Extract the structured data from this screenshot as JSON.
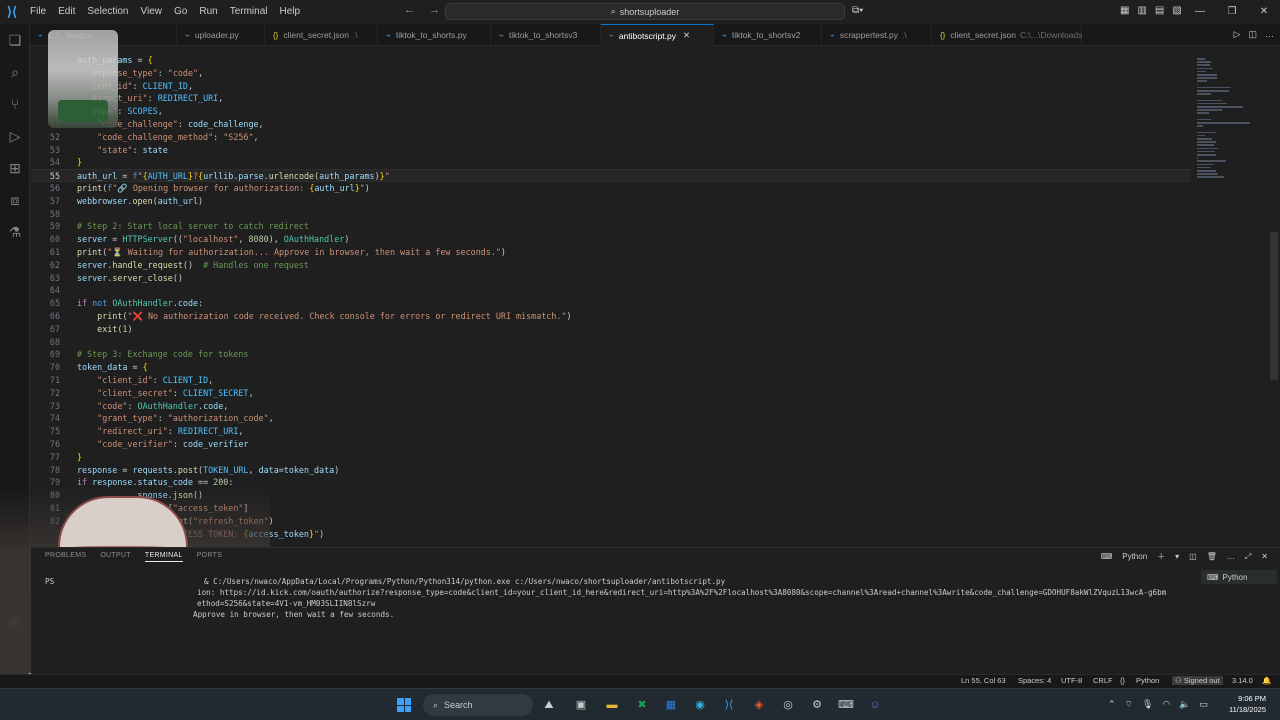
{
  "menu": [
    "File",
    "Edit",
    "Selection",
    "View",
    "Go",
    "Run",
    "Terminal",
    "Help"
  ],
  "search_box": "shortsuploader",
  "tabs": [
    {
      "label": "C:\\...\\nwaco",
      "hint": "",
      "type": "py"
    },
    {
      "label": "uploader.py",
      "hint": "",
      "type": "py"
    },
    {
      "label": "client_secret.json",
      "hint": ".\\",
      "type": "json"
    },
    {
      "label": "tiktok_to_shorts.py",
      "hint": "",
      "type": "py"
    },
    {
      "label": "tiktok_to_shortsv3",
      "hint": "",
      "type": "py"
    },
    {
      "label": "antibotscript.py",
      "hint": "",
      "type": "py",
      "active": true
    },
    {
      "label": "tiktok_to_shortsv2",
      "hint": "",
      "type": "py"
    },
    {
      "label": "scrappertest.py",
      "hint": ".\\",
      "type": "py"
    },
    {
      "label": "client_secret.json",
      "hint": "C:\\...\\Downloads",
      "type": "json"
    }
  ],
  "code_lines": [
    {
      "n": "",
      "parts": [
        [
          "k-var",
          "auth_params"
        ],
        [
          "",
          " = "
        ],
        [
          "k-brace",
          "{"
        ]
      ]
    },
    {
      "n": "",
      "parts": [
        [
          "",
          "   "
        ],
        [
          "k-str",
          "esponse_type\""
        ],
        [
          "",
          ": "
        ],
        [
          "k-str",
          "\"code\""
        ],
        [
          "",
          ","
        ]
      ]
    },
    {
      "n": "",
      "parts": [
        [
          "",
          "   "
        ],
        [
          "k-str",
          "ient_id\""
        ],
        [
          "",
          ": "
        ],
        [
          "k-con",
          "CLIENT_ID"
        ],
        [
          "",
          ","
        ]
      ]
    },
    {
      "n": "",
      "parts": [
        [
          "",
          "   "
        ],
        [
          "k-str",
          "direct_uri\""
        ],
        [
          "",
          ": "
        ],
        [
          "k-con",
          "REDIRECT_URI"
        ],
        [
          "",
          ","
        ]
      ]
    },
    {
      "n": "",
      "parts": [
        [
          "",
          "   "
        ],
        [
          "k-str",
          "cope\""
        ],
        [
          "",
          ": "
        ],
        [
          "k-con",
          "SCOPES"
        ],
        [
          "",
          ","
        ]
      ]
    },
    {
      "n": "51",
      "parts": [
        [
          "",
          "    "
        ],
        [
          "k-str",
          "\"code_challenge\""
        ],
        [
          "",
          ": "
        ],
        [
          "k-var",
          "code_challenge"
        ],
        [
          "",
          ","
        ]
      ]
    },
    {
      "n": "52",
      "parts": [
        [
          "",
          "    "
        ],
        [
          "k-str",
          "\"code_challenge_method\""
        ],
        [
          "",
          ": "
        ],
        [
          "k-str",
          "\"S256\""
        ],
        [
          "",
          ","
        ]
      ]
    },
    {
      "n": "53",
      "parts": [
        [
          "",
          "    "
        ],
        [
          "k-str",
          "\"state\""
        ],
        [
          "",
          ": "
        ],
        [
          "k-var",
          "state"
        ]
      ]
    },
    {
      "n": "54",
      "parts": [
        [
          "k-brace",
          "}"
        ]
      ]
    },
    {
      "n": "55",
      "cur": true,
      "parts": [
        [
          "k-var",
          "auth_url"
        ],
        [
          "",
          " = "
        ],
        [
          "k-bl",
          "f"
        ],
        [
          "k-str",
          "\""
        ],
        [
          "k-brace",
          "{"
        ],
        [
          "k-con",
          "AUTH_URL"
        ],
        [
          "k-brace",
          "}"
        ],
        [
          "k-str",
          "?"
        ],
        [
          "k-brace",
          "{"
        ],
        [
          "k-var",
          "urllib"
        ],
        [
          "",
          "."
        ],
        [
          "k-var",
          "parse"
        ],
        [
          "",
          "."
        ],
        [
          "k-fn",
          "urlencode"
        ],
        [
          "",
          "("
        ],
        [
          "k-var",
          "auth_params"
        ],
        [
          "",
          ")"
        ],
        [
          "k-brace",
          "}"
        ],
        [
          "k-str",
          "\""
        ]
      ]
    },
    {
      "n": "56",
      "parts": [
        [
          "k-fn",
          "print"
        ],
        [
          "",
          "("
        ],
        [
          "k-bl",
          "f"
        ],
        [
          "k-str",
          "\"🔗 Opening browser for authorization: "
        ],
        [
          "k-brace",
          "{"
        ],
        [
          "k-var",
          "auth_url"
        ],
        [
          "k-brace",
          "}"
        ],
        [
          "k-str",
          "\""
        ],
        [
          "",
          ")"
        ]
      ]
    },
    {
      "n": "57",
      "parts": [
        [
          "k-var",
          "webbrowser"
        ],
        [
          "",
          "."
        ],
        [
          "k-fn",
          "open"
        ],
        [
          "",
          "("
        ],
        [
          "k-var",
          "auth_url"
        ],
        [
          "",
          ")"
        ]
      ]
    },
    {
      "n": "58",
      "parts": [
        [
          "",
          ""
        ]
      ]
    },
    {
      "n": "59",
      "parts": [
        [
          "k-com",
          "# Step 2: Start local server to catch redirect"
        ]
      ]
    },
    {
      "n": "60",
      "parts": [
        [
          "k-var",
          "server"
        ],
        [
          "",
          " = "
        ],
        [
          "k-cls",
          "HTTPServer"
        ],
        [
          "",
          "(("
        ],
        [
          "k-str",
          "\"localhost\""
        ],
        [
          "",
          ", "
        ],
        [
          "k-num",
          "8080"
        ],
        [
          "",
          "), "
        ],
        [
          "k-cls",
          "OAuthHandler"
        ],
        [
          "",
          ")"
        ]
      ]
    },
    {
      "n": "61",
      "parts": [
        [
          "k-fn",
          "print"
        ],
        [
          "",
          "("
        ],
        [
          "k-str",
          "\"⏳ Waiting for authorization... Approve in browser, then wait a few seconds.\""
        ],
        [
          "",
          ")"
        ]
      ]
    },
    {
      "n": "62",
      "parts": [
        [
          "k-var",
          "server"
        ],
        [
          "",
          "."
        ],
        [
          "k-fn",
          "handle_request"
        ],
        [
          "",
          "()  "
        ],
        [
          "k-com",
          "# Handles one request"
        ]
      ]
    },
    {
      "n": "63",
      "parts": [
        [
          "k-var",
          "server"
        ],
        [
          "",
          "."
        ],
        [
          "k-fn",
          "server_close"
        ],
        [
          "",
          "()"
        ]
      ]
    },
    {
      "n": "64",
      "parts": [
        [
          "",
          ""
        ]
      ]
    },
    {
      "n": "65",
      "parts": [
        [
          "k-kw",
          "if"
        ],
        [
          "",
          " "
        ],
        [
          "k-bl",
          "not"
        ],
        [
          "",
          " "
        ],
        [
          "k-cls",
          "OAuthHandler"
        ],
        [
          "",
          "."
        ],
        [
          "k-var",
          "code"
        ],
        [
          "",
          ":"
        ]
      ]
    },
    {
      "n": "66",
      "parts": [
        [
          "",
          "    "
        ],
        [
          "k-fn",
          "print"
        ],
        [
          "",
          "("
        ],
        [
          "k-str",
          "\"❌ No authorization code received. Check console for errors or redirect URI mismatch.\""
        ],
        [
          "",
          ")"
        ]
      ]
    },
    {
      "n": "67",
      "parts": [
        [
          "",
          "    "
        ],
        [
          "k-fn",
          "exit"
        ],
        [
          "",
          "("
        ],
        [
          "k-num",
          "1"
        ],
        [
          "",
          ")"
        ]
      ]
    },
    {
      "n": "68",
      "parts": [
        [
          "",
          ""
        ]
      ]
    },
    {
      "n": "69",
      "parts": [
        [
          "k-com",
          "# Step 3: Exchange code for tokens"
        ]
      ]
    },
    {
      "n": "70",
      "parts": [
        [
          "k-var",
          "token_data"
        ],
        [
          "",
          " = "
        ],
        [
          "k-brace",
          "{"
        ]
      ]
    },
    {
      "n": "71",
      "parts": [
        [
          "",
          "    "
        ],
        [
          "k-str",
          "\"client_id\""
        ],
        [
          "",
          ": "
        ],
        [
          "k-con",
          "CLIENT_ID"
        ],
        [
          "",
          ","
        ]
      ]
    },
    {
      "n": "72",
      "parts": [
        [
          "",
          "    "
        ],
        [
          "k-str",
          "\"client_secret\""
        ],
        [
          "",
          ": "
        ],
        [
          "k-con",
          "CLIENT_SECRET"
        ],
        [
          "",
          ","
        ]
      ]
    },
    {
      "n": "73",
      "parts": [
        [
          "",
          "    "
        ],
        [
          "k-str",
          "\"code\""
        ],
        [
          "",
          ": "
        ],
        [
          "k-cls",
          "OAuthHandler"
        ],
        [
          "",
          "."
        ],
        [
          "k-var",
          "code"
        ],
        [
          "",
          ","
        ]
      ]
    },
    {
      "n": "74",
      "parts": [
        [
          "",
          "    "
        ],
        [
          "k-str",
          "\"grant_type\""
        ],
        [
          "",
          ": "
        ],
        [
          "k-str",
          "\"authorization_code\""
        ],
        [
          "",
          ","
        ]
      ]
    },
    {
      "n": "75",
      "parts": [
        [
          "",
          "    "
        ],
        [
          "k-str",
          "\"redirect_uri\""
        ],
        [
          "",
          ": "
        ],
        [
          "k-con",
          "REDIRECT_URI"
        ],
        [
          "",
          ","
        ]
      ]
    },
    {
      "n": "76",
      "parts": [
        [
          "",
          "    "
        ],
        [
          "k-str",
          "\"code_verifier\""
        ],
        [
          "",
          ": "
        ],
        [
          "k-var",
          "code_verifier"
        ]
      ]
    },
    {
      "n": "77",
      "parts": [
        [
          "k-brace",
          "}"
        ]
      ]
    },
    {
      "n": "78",
      "parts": [
        [
          "k-var",
          "response"
        ],
        [
          "",
          " = "
        ],
        [
          "k-var",
          "requests"
        ],
        [
          "",
          "."
        ],
        [
          "k-fn",
          "post"
        ],
        [
          "",
          "("
        ],
        [
          "k-con",
          "TOKEN_URL"
        ],
        [
          "",
          ", "
        ],
        [
          "k-var",
          "data"
        ],
        [
          "",
          "="
        ],
        [
          "k-var",
          "token_data"
        ],
        [
          "",
          ")"
        ]
      ]
    },
    {
      "n": "79",
      "parts": [
        [
          "k-kw",
          "if"
        ],
        [
          "",
          " "
        ],
        [
          "k-var",
          "response"
        ],
        [
          "",
          "."
        ],
        [
          "k-var",
          "status_code"
        ],
        [
          "",
          " == "
        ],
        [
          "k-num",
          "200"
        ],
        [
          "",
          ":"
        ]
      ]
    },
    {
      "n": "80",
      "parts": [
        [
          "",
          "            "
        ],
        [
          "k-var",
          "sponse"
        ],
        [
          "",
          "."
        ],
        [
          "k-fn",
          "json"
        ],
        [
          "",
          "()"
        ]
      ]
    },
    {
      "n": "81",
      "parts": [
        [
          "",
          "            "
        ],
        [
          "k-var",
          "tokens"
        ],
        [
          "",
          "["
        ],
        [
          "k-str",
          "\"access_token\""
        ],
        [
          "",
          "]"
        ]
      ]
    },
    {
      "n": "82",
      "parts": [
        [
          "",
          "            "
        ],
        [
          "k-var",
          "tokens"
        ],
        [
          "",
          "."
        ],
        [
          "k-fn",
          "get"
        ],
        [
          "",
          "("
        ],
        [
          "k-str",
          "\"refresh_token\""
        ],
        [
          "",
          ")"
        ]
      ]
    },
    {
      "n": "",
      "parts": [
        [
          "",
          "            "
        ],
        [
          "k-str",
          "CCESS! ACCESS TOKEN: "
        ],
        [
          "k-brace",
          "{"
        ],
        [
          "k-var",
          "access_token"
        ],
        [
          "k-brace",
          "}"
        ],
        [
          "k-str",
          "\""
        ],
        [
          "",
          ")"
        ]
      ]
    }
  ],
  "panel": {
    "tabs": [
      "PROBLEMS",
      "OUTPUT",
      "TERMINAL",
      "PORTS"
    ],
    "active_tab": "TERMINAL",
    "profile": "Python",
    "terminal_list_item": "Python",
    "lines": [
      {
        "prefix": "PS",
        "text": "& C:/Users/nwaco/AppData/Local/Programs/Python/Python314/python.exe c:/Users/nwaco/shortsuploader/antibotscript.py"
      },
      {
        "prefix": "",
        "text": "ion: https://id.kick.com/oauth/authorize?response_type=code&client_id=your_client_id_here&redirect_uri=http%3A%2F%2Flocalhost%3A8080&scope=channel%3Aread+channel%3Awrite&code_challenge=GDOHUF8akWlZVquzL13wcA-g6bm"
      },
      {
        "prefix": "",
        "text": "ethod=S256&state=4V1-vm_HM03SLIIN8lSzrw"
      },
      {
        "prefix": "",
        "text": "Approve in browser, then wait a few seconds."
      }
    ]
  },
  "status": {
    "position": "Ln 55, Col 63",
    "spaces": "Spaces: 4",
    "encoding": "UTF-8",
    "eol": "CRLF",
    "language": "Python",
    "account": "Signed out",
    "version": "3.14.0"
  },
  "taskbar": {
    "search": "Search",
    "time": "9:06 PM",
    "date": "11/18/2025"
  },
  "colors": {
    "accent": "#0078d4",
    "editor_bg": "#1f1f1f",
    "sidebar_bg": "#181818"
  }
}
